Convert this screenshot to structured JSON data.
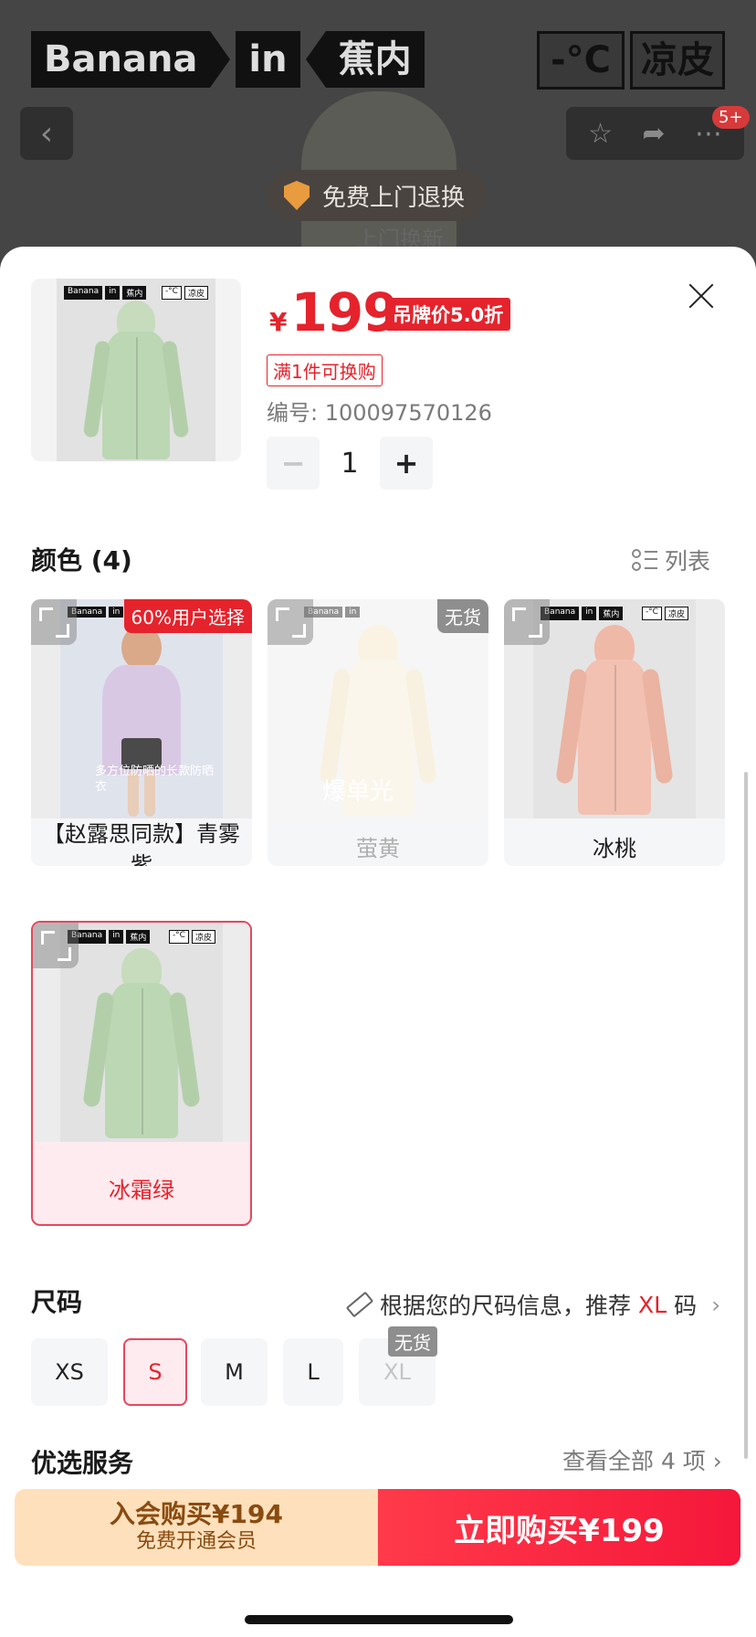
{
  "background": {
    "brand": [
      "Banana",
      "in",
      "蕉内"
    ],
    "tags": [
      "-°C",
      "凉皮"
    ],
    "badge_count": "5+",
    "pill_text": "免费上门退换",
    "faded_text": "上门换新"
  },
  "product": {
    "currency": "¥",
    "price": "199",
    "discount_tag": "吊牌价5.0折",
    "promo_tag": "满1件可换购",
    "sku": "编号: 100097570126",
    "quantity": "1",
    "minus": "−",
    "plus": "+"
  },
  "color_section": {
    "title": "颜色 (4)",
    "list_label": "列表",
    "options": [
      {
        "label": "【赵露思同款】青雾紫",
        "badge": "60%用户选择",
        "state": "normal"
      },
      {
        "label": "萤黄",
        "badge": "无货",
        "state": "sold_out",
        "overlay": "爆单光"
      },
      {
        "label": "冰桃",
        "badge": "",
        "state": "normal"
      },
      {
        "label": "冰霜绿",
        "badge": "",
        "state": "selected"
      }
    ],
    "person_caption": "多方位防晒的长款防晒衣"
  },
  "size_section": {
    "title": "尺码",
    "tip_prefix": "根据您的尺码信息，推荐",
    "tip_size": "XL",
    "tip_suffix": "码",
    "sizes": [
      "XS",
      "S",
      "M",
      "L",
      "XL"
    ],
    "selected": "S",
    "sold_out_badge": "无货"
  },
  "services": {
    "title": "优选服务",
    "view_all": "查看全部 4 项 ›"
  },
  "actions": {
    "member_main": "入会购买¥194",
    "member_sub": "免费开通会员",
    "buy_now": "立即购买¥199"
  },
  "colors": {
    "accent": "#e5232c",
    "member_bg": "#ffe0bc",
    "coat_green": "#bcd7b4",
    "coat_purple": "#d9c8e3",
    "coat_yellow": "#f5ecd2",
    "coat_peach": "#f2c1b2"
  }
}
